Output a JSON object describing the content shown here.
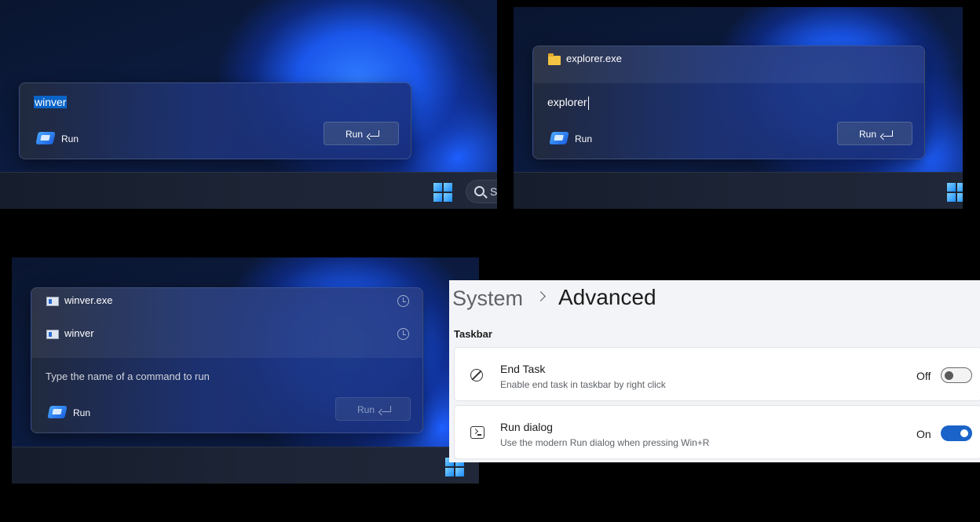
{
  "panel1": {
    "input_value": "winver",
    "run_label": "Run",
    "button_label": "Run",
    "search_text": "S"
  },
  "panel2": {
    "suggestion": "explorer.exe",
    "input_value": "explorer",
    "run_label": "Run",
    "button_label": "Run"
  },
  "panel3": {
    "history": [
      "winver.exe",
      "winver"
    ],
    "placeholder": "Type the name of a command to run",
    "run_label": "Run",
    "button_label": "Run"
  },
  "settings": {
    "breadcrumb_parent": "System",
    "breadcrumb_current": "Advanced",
    "section": "Taskbar",
    "items": [
      {
        "title": "End Task",
        "description": "Enable end task in taskbar by right click",
        "state": "Off",
        "on": false
      },
      {
        "title": "Run dialog",
        "description": "Use the modern Run dialog when pressing Win+R",
        "state": "On",
        "on": true
      }
    ]
  },
  "colors": {
    "accent": "#1a63c9",
    "selection": "#0a64c8"
  }
}
